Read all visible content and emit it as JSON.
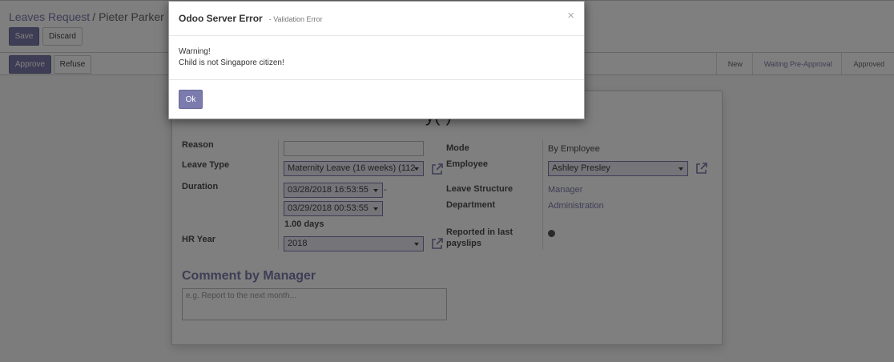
{
  "breadcrumb": {
    "parent": "Leaves Request",
    "separator": "/",
    "current": "Pieter Parker"
  },
  "toolbar": {
    "save_label": "Save",
    "discard_label": "Discard"
  },
  "statusbar": {
    "approve_label": "Approve",
    "refuse_label": "Refuse",
    "stages": [
      "New",
      "Waiting Pre-Approval",
      "Approved"
    ],
    "active_stage": "Waiting Pre-Approval"
  },
  "form": {
    "title_fragment": "y(-)",
    "reason": {
      "label": "Reason",
      "value": ""
    },
    "leave_type": {
      "label": "Leave Type",
      "value": "Maternity Leave (16 weeks)  (112"
    },
    "duration": {
      "label": "Duration",
      "from": "03/28/2018 16:53:55",
      "dash": "-",
      "to": "03/29/2018 00:53:55",
      "days": "1.00 days"
    },
    "hr_year": {
      "label": "HR Year",
      "value": "2018"
    },
    "mode": {
      "label": "Mode",
      "value": "By Employee"
    },
    "employee": {
      "label": "Employee",
      "value": "Ashley Presley"
    },
    "leave_structure": {
      "label": "Leave Structure",
      "value": "Manager"
    },
    "department": {
      "label": "Department",
      "value": "Administration"
    },
    "reported": {
      "label_line1": "Reported in last",
      "label_line2": "payslips"
    },
    "comment": {
      "title": "Comment by Manager",
      "placeholder": "e.g. Report to the next month..."
    }
  },
  "modal": {
    "title": "Odoo Server Error",
    "subtitle": "- Validation Error",
    "close_glyph": "×",
    "message_line1": "Warning!",
    "message_line2": "Child is not Singapore citizen!",
    "ok_label": "Ok"
  },
  "colors": {
    "brand": "#7c7bad",
    "overlay": "rgba(0,0,0,0.5)"
  }
}
